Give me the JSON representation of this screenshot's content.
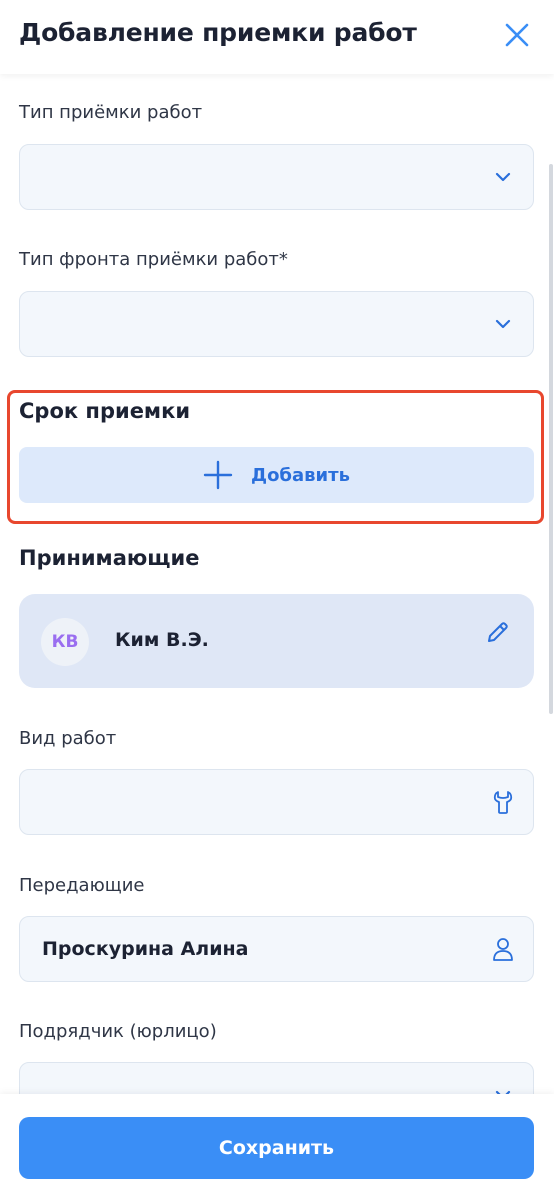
{
  "header": {
    "title": "Добавление приемки работ",
    "close_icon": "close-icon"
  },
  "form": {
    "acceptance_type": {
      "label": "Тип приёмки работ",
      "value": "",
      "icon": "chevron-down-icon"
    },
    "front_type": {
      "label": "Тип фронта приёмки работ*",
      "value": "",
      "icon": "chevron-down-icon"
    },
    "deadline": {
      "title": "Срок приемки",
      "add_label": "Добавить",
      "icon": "plus-icon"
    },
    "receivers": {
      "title": "Принимающие",
      "person": {
        "initials": "КВ",
        "name": "Ким В.Э.",
        "icon": "pencil-icon"
      }
    },
    "work_type": {
      "label": "Вид работ",
      "value": "",
      "icon": "wrench-icon"
    },
    "transferors": {
      "label": "Передающие",
      "value": "Проскурина Алина",
      "icon": "user-icon"
    },
    "contractor": {
      "label": "Подрядчик (юрлицо)",
      "value": "",
      "icon": "chevron-down-icon"
    }
  },
  "footer": {
    "save_label": "Сохранить"
  },
  "colors": {
    "accent": "#3a8ef6",
    "link": "#2a6fdb",
    "highlight": "#e8472e",
    "avatar_text": "#9a6ef0"
  }
}
